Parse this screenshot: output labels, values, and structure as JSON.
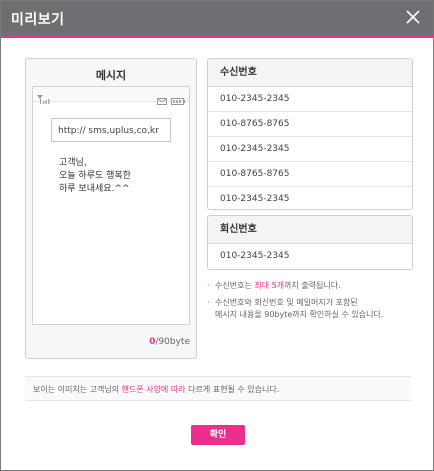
{
  "dialog": {
    "title": "미리보기",
    "close_icon": "close-icon"
  },
  "phone": {
    "title": "메시지",
    "status_icons": [
      "signal-icon",
      "message-icon",
      "battery-icon"
    ],
    "url": "http:// sms,uplus,co,kr",
    "message": "고객님,\n오늘 하루도 행복한\n하루 보내세요.^^",
    "byte_current": "0",
    "byte_max": "/90byte"
  },
  "recipients": {
    "header": "수신번호",
    "numbers": [
      "010-2345-2345",
      "010-8765-8765",
      "010-2345-2345",
      "010-8765-8765",
      "010-2345-2345"
    ]
  },
  "reply": {
    "header": "회신번호",
    "number": "010-2345-2345"
  },
  "notes": {
    "note1_pre": "수신번호는 ",
    "note1_highlight": "최대 5개",
    "note1_post": "까지 출력됩니다.",
    "note2_line1": "수신번호와 회신번호 및 메일머지가 포함된",
    "note2_line2": "메시지 내용을 90byte까지 확인하실 수 있습니다."
  },
  "bottom_note": {
    "pre": "보이는 이미지는 고객님의 ",
    "highlight": "핸드폰 사양에 따라",
    "post": " 다르게 표현될 수 있습니다."
  },
  "ok_button": "확인",
  "colors": {
    "accent": "#e6338c",
    "titlebar": "#6e6e73"
  }
}
